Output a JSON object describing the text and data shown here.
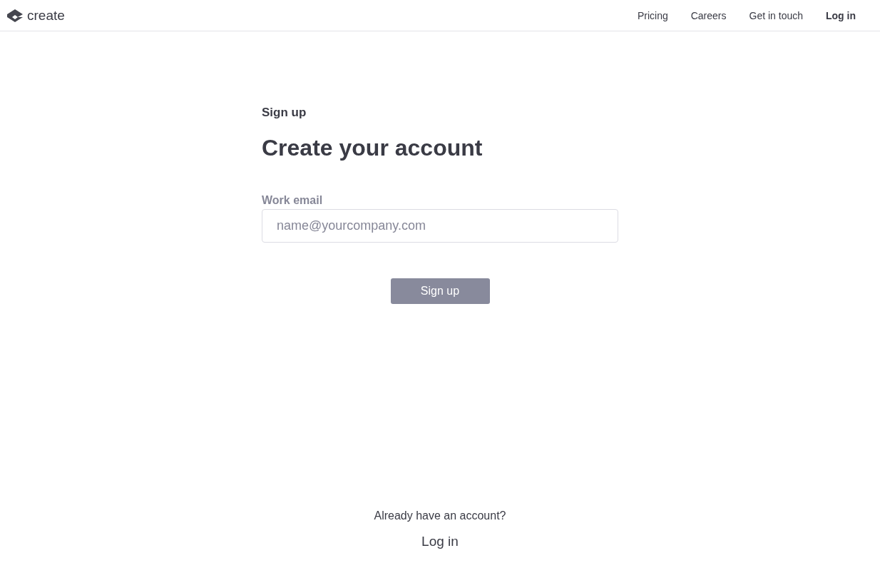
{
  "header": {
    "logo": "create",
    "nav": [
      {
        "label": "Pricing",
        "kind": "link"
      },
      {
        "label": "Careers",
        "kind": "link"
      },
      {
        "label": "Get in touch",
        "kind": "link"
      },
      {
        "label": "Log in",
        "kind": "strong"
      }
    ]
  },
  "form": {
    "eyebrow": "Sign up",
    "title": "Create your account",
    "email": {
      "label": "Work email",
      "placeholder": "name@yourcompany.com"
    },
    "submit": {
      "label": "Sign up",
      "disabled": true
    }
  },
  "footer": {
    "prompt": "Already have an account?",
    "link": "Log in"
  }
}
